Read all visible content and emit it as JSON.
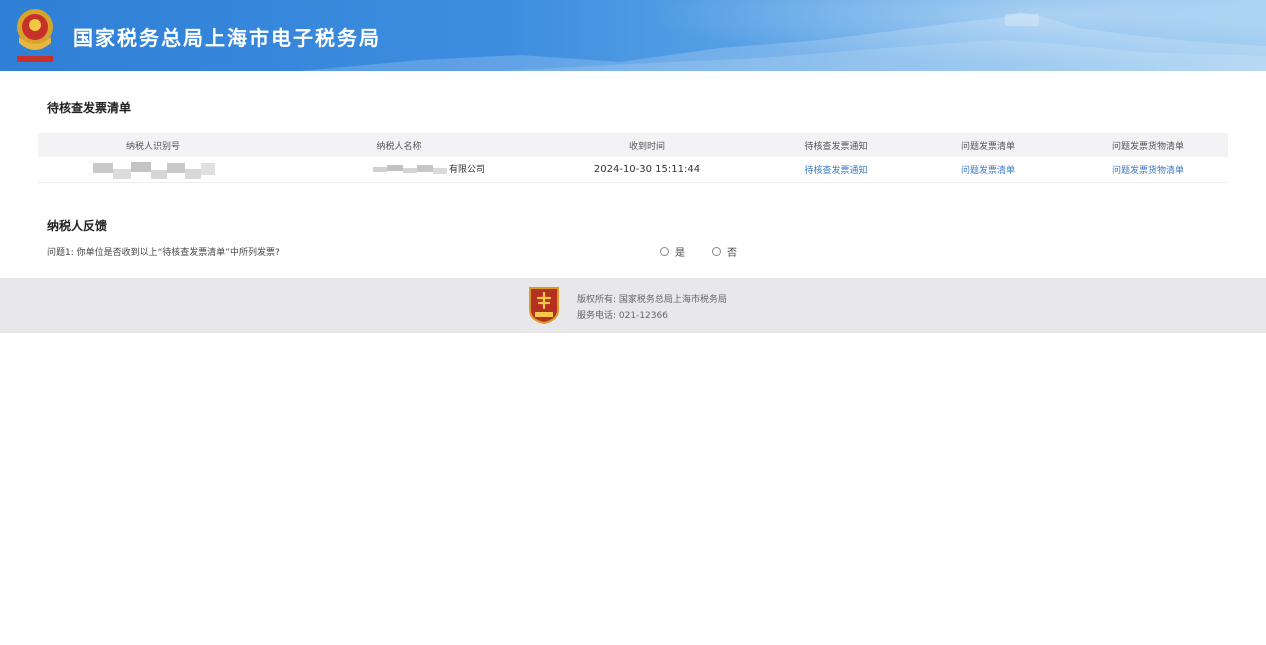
{
  "header": {
    "title": "国家税务总局上海市电子税务局",
    "colors": {
      "bar": "#3d8ee0",
      "title": "#ffffff"
    }
  },
  "pending_section": {
    "title": "待核查发票清单",
    "columns": [
      "纳税人识别号",
      "纳税人名称",
      "收到时间",
      "待核查发票通知",
      "问题发票清单",
      "问题发票货物清单"
    ],
    "rows": [
      {
        "taxpayer_id": "",
        "taxpayer_name_suffix": "有限公司",
        "received_time": "2024-10-30 15:11:44",
        "notice_link": "待核查发票通知",
        "problem_list_link": "问题发票清单",
        "goods_list_link": "问题发票货物清单"
      }
    ]
  },
  "feedback_section": {
    "title": "纳税人反馈",
    "question": "问题1: 你单位是否收到以上“待核查发票清单”中所列发票?",
    "options": [
      "是",
      "否"
    ]
  },
  "footer": {
    "copyright": "版权所有: 国家税务总局上海市税务局",
    "phone": "服务电话: 021-12366"
  },
  "colors": {
    "link": "#3a78c9",
    "footer_bg": "#e8e8eb",
    "table_header_bg": "#f3f3f5"
  }
}
